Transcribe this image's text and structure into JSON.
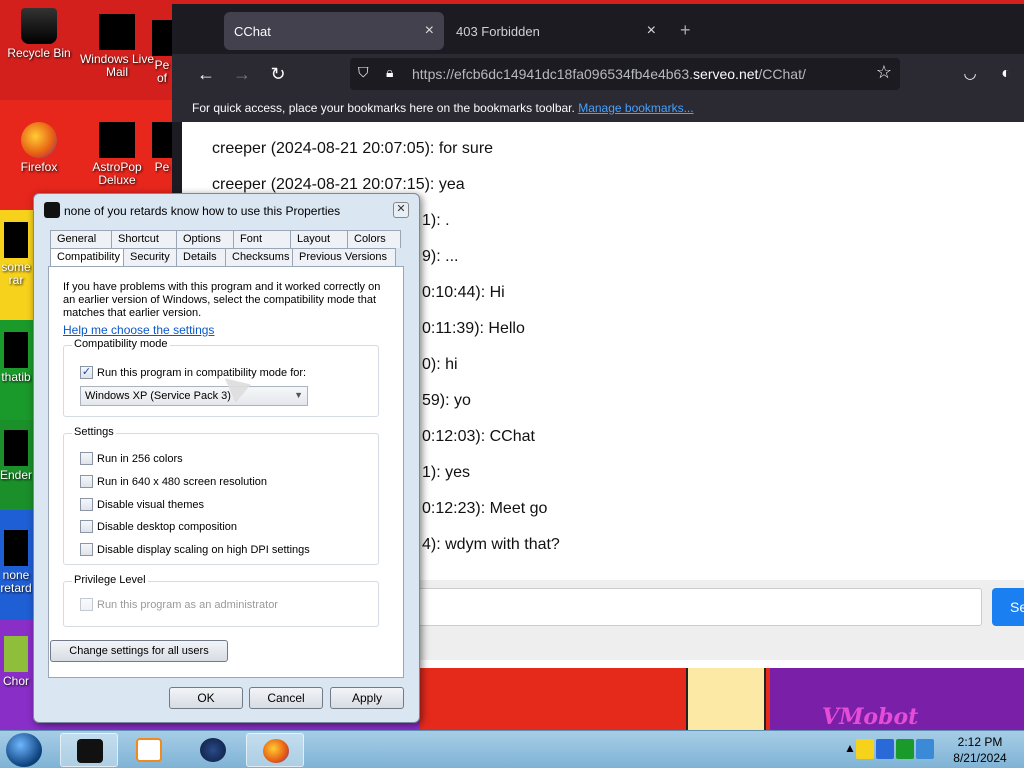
{
  "desktop": {
    "icons": [
      {
        "label": "Recycle Bin"
      },
      {
        "label": "Windows Live Mail"
      },
      {
        "label": "Pe of"
      },
      {
        "label": "Firefox"
      },
      {
        "label": "AstroPop Deluxe"
      },
      {
        "label": "Pe"
      },
      {
        "label": "some rar"
      },
      {
        "label": "thatib"
      },
      {
        "label": "Ender"
      },
      {
        "label": "none retard"
      },
      {
        "label": "Chor"
      }
    ],
    "wall_logo": "VMobot"
  },
  "browser": {
    "tabs": [
      {
        "label": "CChat",
        "close": "×"
      },
      {
        "label": "403 Forbidden",
        "close": "×"
      }
    ],
    "new_tab": "+",
    "url": {
      "prefix": "https://efcb6dc14941dc18fa096534fb4e4b63.",
      "host": "serveo.net",
      "path": "/CChat/"
    },
    "bookmarks_bar": {
      "text": "For quick access, place your bookmarks here on the bookmarks toolbar.",
      "link": "Manage bookmarks..."
    },
    "messages": [
      "creeper (2024-08-21 20:07:05): for sure",
      "creeper (2024-08-21 20:07:15): yea",
      "1): .",
      "9): ...",
      "0:10:44): Hi",
      "0:11:39): Hello",
      "0): hi",
      "59): yo",
      "0:12:03): CChat",
      "1): yes",
      "0:12:23): Meet go",
      "4): wdym with that?"
    ],
    "send_label": "Se"
  },
  "dialog": {
    "title": "none of you retards know how to use this Properties",
    "close": "✕",
    "tabs_row1": [
      "General",
      "Shortcut",
      "Options",
      "Font",
      "Layout",
      "Colors"
    ],
    "tabs_row2": [
      "Compatibility",
      "Security",
      "Details",
      "Checksums",
      "Previous Versions"
    ],
    "intro": "If you have problems with this program and it worked correctly on an earlier version of Windows, select the compatibility mode that matches that earlier version.",
    "help_link": "Help me choose the settings",
    "compat_group": "Compatibility mode",
    "compat_check": "Run this program in compatibility mode for:",
    "compat_value": "Windows XP (Service Pack 3)",
    "settings_group": "Settings",
    "settings": [
      "Run in 256 colors",
      "Run in 640 x 480 screen resolution",
      "Disable visual themes",
      "Disable desktop composition",
      "Disable display scaling on high DPI settings"
    ],
    "privilege_group": "Privilege Level",
    "privilege_check": "Run this program as an administrator",
    "change_all": "Change settings for all users",
    "ok": "OK",
    "cancel": "Cancel",
    "apply": "Apply"
  },
  "taskbar": {
    "clock_time": "2:12 PM",
    "clock_date": "8/21/2024",
    "tray_up": "▲"
  }
}
